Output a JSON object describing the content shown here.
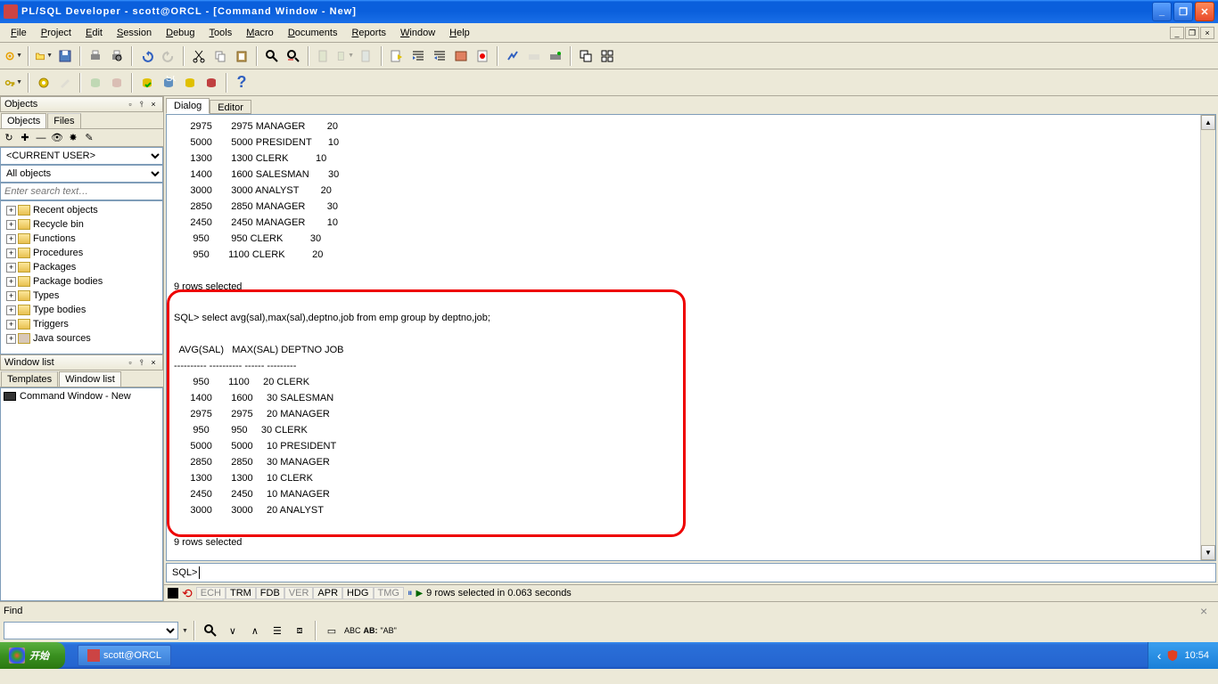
{
  "title": "PL/SQL Developer - scott@ORCL - [Command Window - New]",
  "menus": [
    "File",
    "Project",
    "Edit",
    "Session",
    "Debug",
    "Tools",
    "Macro",
    "Documents",
    "Reports",
    "Window",
    "Help"
  ],
  "objects_panel": {
    "title": "Objects",
    "tabs": [
      "Objects",
      "Files"
    ],
    "user_combo": "<CURRENT USER>",
    "filter_combo": "All objects",
    "search_placeholder": "Enter search text…",
    "tree": [
      "Recent objects",
      "Recycle bin",
      "Functions",
      "Procedures",
      "Packages",
      "Package bodies",
      "Types",
      "Type bodies",
      "Triggers",
      "Java sources"
    ]
  },
  "winlist_panel": {
    "title": "Window list",
    "tabs": [
      "Templates",
      "Window list"
    ],
    "items": [
      "Command Window - New"
    ]
  },
  "content": {
    "tabs": [
      "Dialog",
      "Editor"
    ],
    "output_top": "      2975       2975 MANAGER        20\n      5000       5000 PRESIDENT      10\n      1300       1300 CLERK          10\n      1400       1600 SALESMAN       30\n      3000       3000 ANALYST        20\n      2850       2850 MANAGER        30\n      2450       2450 MANAGER        10\n       950        950 CLERK          30\n       950       1100 CLERK          20\n\n9 rows selected\n",
    "output_boxed": "SQL> select avg(sal),max(sal),deptno,job from emp group by deptno,job;\n\n  AVG(SAL)   MAX(SAL) DEPTNO JOB\n---------- ---------- ------ ---------\n       950       1100     20 CLERK\n      1400       1600     30 SALESMAN\n      2975       2975     20 MANAGER\n       950        950     30 CLERK\n      5000       5000     10 PRESIDENT\n      2850       2850     30 MANAGER\n      1300       1300     10 CLERK\n      2450       2450     10 MANAGER\n      3000       3000     20 ANALYST\n\n9 rows selected\n",
    "prompt": "SQL>"
  },
  "statusbar": {
    "flags": [
      "ECH",
      "TRM",
      "FDB",
      "VER",
      "APR",
      "HDG",
      "TMG"
    ],
    "msg": "9 rows selected in 0.063 seconds"
  },
  "findbar": {
    "label": "Find",
    "opt": "\"AB\""
  },
  "taskbar": {
    "start": "开始",
    "task": "scott@ORCL",
    "time": "10:54"
  }
}
